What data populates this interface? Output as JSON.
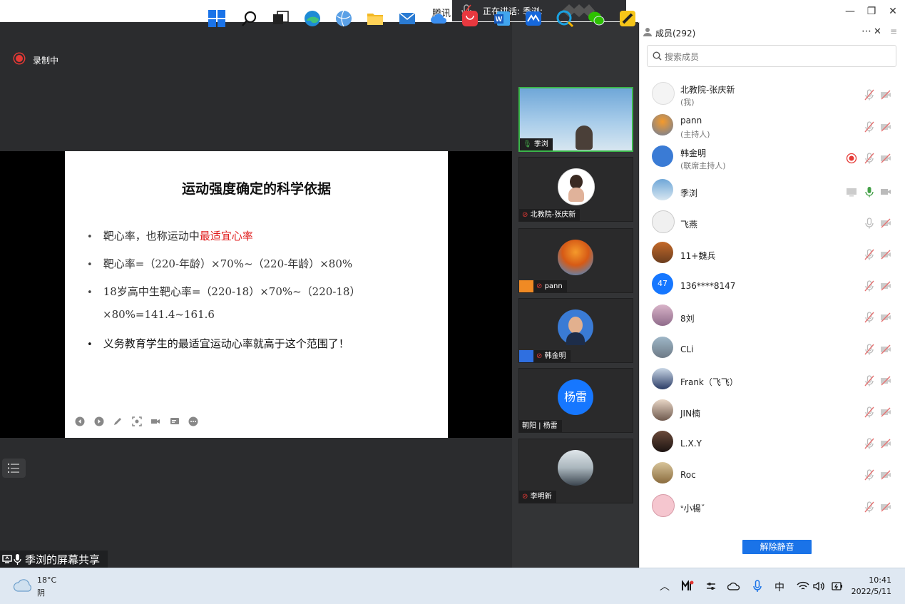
{
  "window": {
    "title": "腾讯",
    "speaking_label": "正在讲话: 季浏:",
    "minimize": "—",
    "maximize": "❐",
    "close": "✕"
  },
  "recording": {
    "label": "录制中",
    "color": "#e53935"
  },
  "slide": {
    "title": "运动强度确定的科学依据",
    "bullets": [
      {
        "text": "靶心率，也称运动中",
        "highlight": "最适宜心率"
      },
      {
        "text": "靶心率=（220-年龄）×70%~（220-年龄）×80%"
      },
      {
        "text": "18岁高中生靶心率=（220-18）×70%~（220-18）",
        "cont": "×80%=141.4~161.6"
      },
      {
        "text": "义务教育学生的最适宜运动心率就高于这个范围了！"
      }
    ],
    "highlight_color": "#e02020"
  },
  "share_label": "季浏的屏幕共享",
  "video_tiles": [
    {
      "name": "季浏",
      "mic": "on"
    },
    {
      "name": "北教院-张庆新",
      "mic": "muted"
    },
    {
      "name": "pann",
      "mic": "muted"
    },
    {
      "name": "韩金明",
      "mic": "muted"
    },
    {
      "name": "朝阳 | 杨雷",
      "avatar_text": "杨雷"
    },
    {
      "name": "李明新",
      "mic": "muted"
    }
  ],
  "panel": {
    "title": "成员(292)",
    "search_placeholder": "搜索成员",
    "unmute_label": "解除静音",
    "members": [
      {
        "name": "北教院-张庆新",
        "role": "(我)"
      },
      {
        "name": "pann",
        "role": "(主持人)"
      },
      {
        "name": "韩金明",
        "role": "(联席主持人)",
        "recording": true
      },
      {
        "name": "季浏",
        "speaking": true
      },
      {
        "name": "飞燕"
      },
      {
        "name": "11+魏兵"
      },
      {
        "name": "136****8147",
        "avatar_text": "47"
      },
      {
        "name": "8刘"
      },
      {
        "name": "CLi"
      },
      {
        "name": "Frank（飞飞）"
      },
      {
        "name": "JIN楠"
      },
      {
        "name": "L.X.Y"
      },
      {
        "name": "Roc"
      },
      {
        "name": "ᐡ小楊ˇ"
      }
    ]
  },
  "taskbar": {
    "weather_temp": "18°C",
    "weather_desc": "阴",
    "ime": "中",
    "time": "10:41",
    "date": "2022/5/11"
  },
  "colors": {
    "accent": "#1a73e8",
    "mic_active": "#43a047",
    "muted_red": "#e53935"
  }
}
